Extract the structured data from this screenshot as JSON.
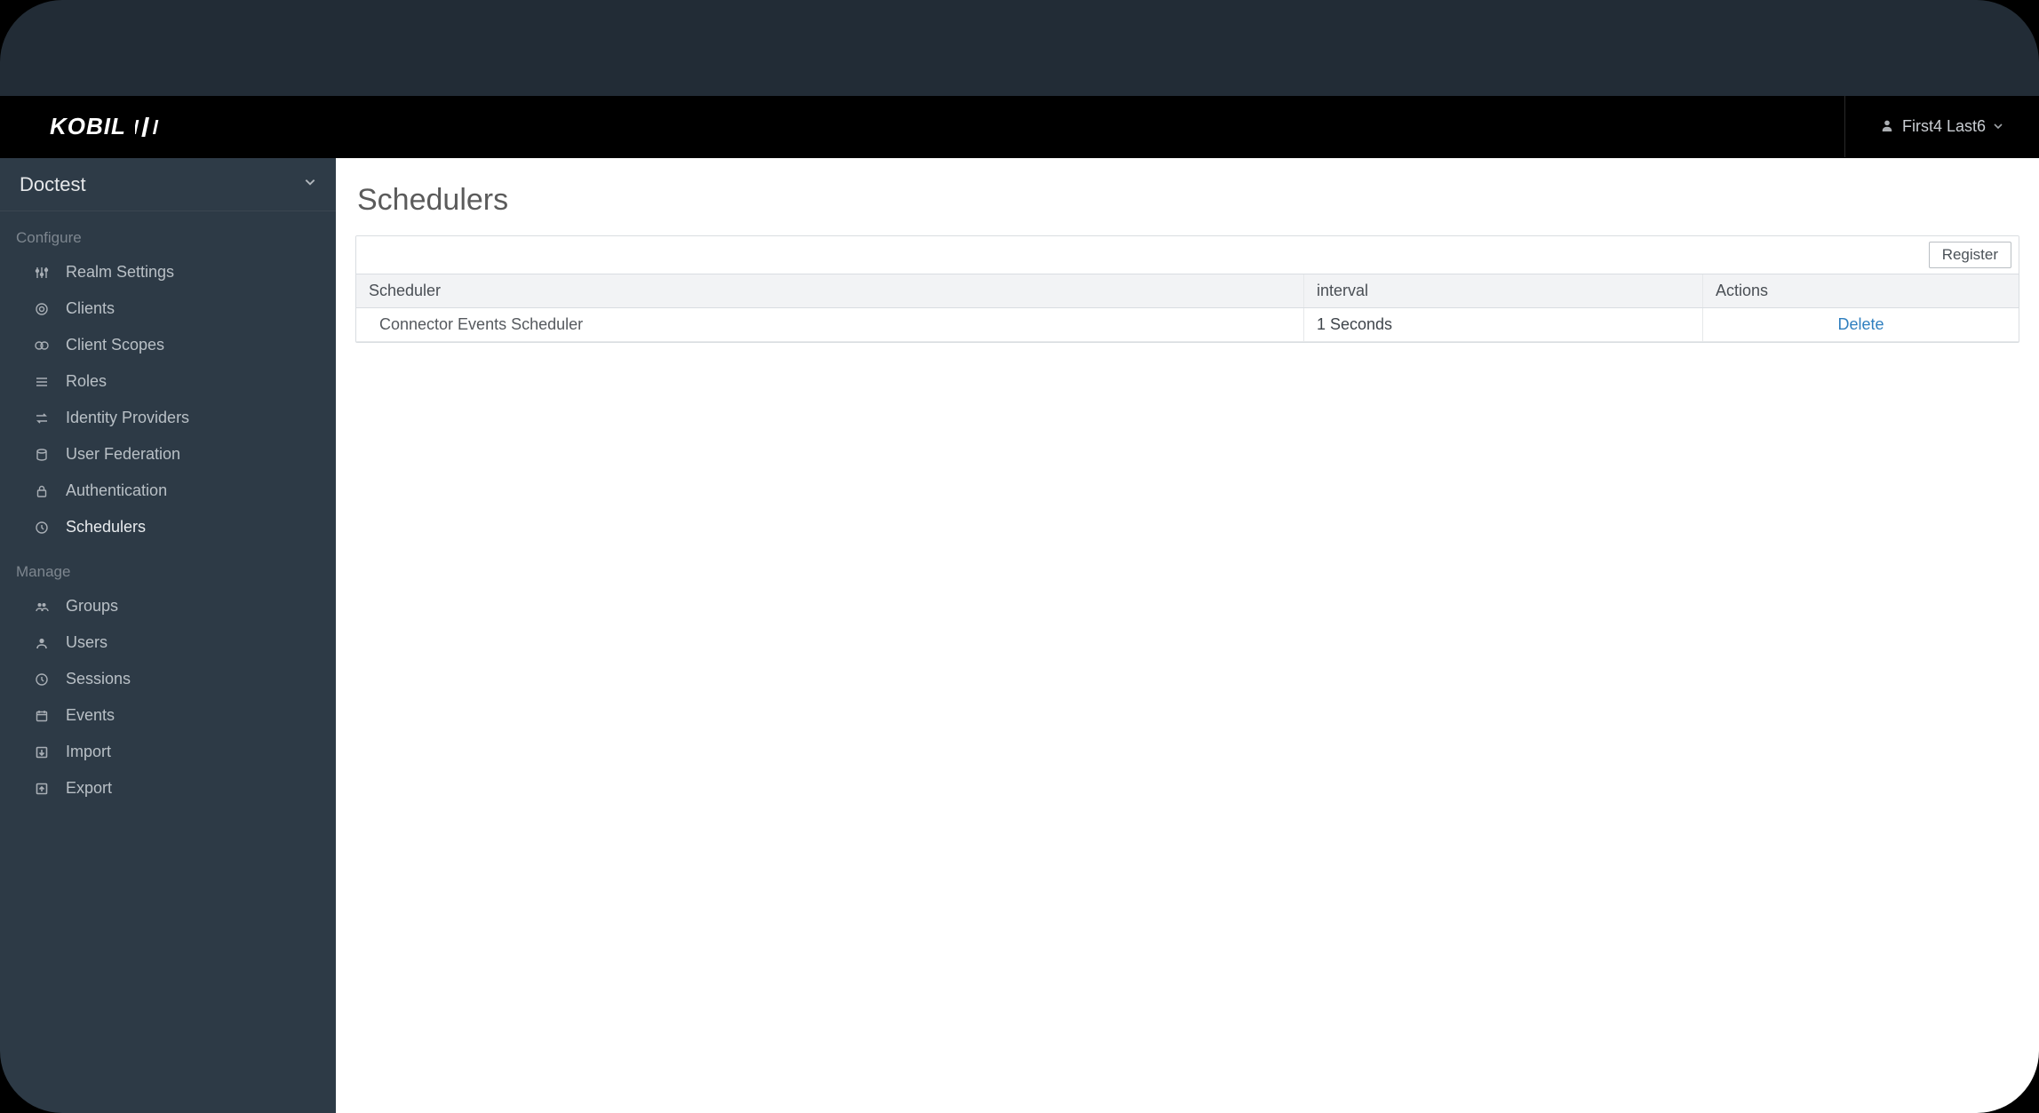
{
  "brand": {
    "name": "KOBIL"
  },
  "header": {
    "user_label": "First4 Last6"
  },
  "sidebar": {
    "realm_label": "Doctest",
    "sections": [
      {
        "title": "Configure",
        "items": [
          {
            "id": "realm-settings",
            "label": "Realm Settings",
            "icon": "sliders"
          },
          {
            "id": "clients",
            "label": "Clients",
            "icon": "target"
          },
          {
            "id": "client-scopes",
            "label": "Client Scopes",
            "icon": "scopes"
          },
          {
            "id": "roles",
            "label": "Roles",
            "icon": "list"
          },
          {
            "id": "identity-providers",
            "label": "Identity Providers",
            "icon": "swap"
          },
          {
            "id": "user-federation",
            "label": "User Federation",
            "icon": "stack"
          },
          {
            "id": "authentication",
            "label": "Authentication",
            "icon": "lock"
          },
          {
            "id": "schedulers",
            "label": "Schedulers",
            "icon": "clock",
            "active": true
          }
        ]
      },
      {
        "title": "Manage",
        "items": [
          {
            "id": "groups",
            "label": "Groups",
            "icon": "users"
          },
          {
            "id": "users",
            "label": "Users",
            "icon": "user"
          },
          {
            "id": "sessions",
            "label": "Sessions",
            "icon": "clock"
          },
          {
            "id": "events",
            "label": "Events",
            "icon": "calendar"
          },
          {
            "id": "import",
            "label": "Import",
            "icon": "import"
          },
          {
            "id": "export",
            "label": "Export",
            "icon": "export"
          }
        ]
      }
    ]
  },
  "page": {
    "title": "Schedulers",
    "register_label": "Register",
    "columns": {
      "scheduler": "Scheduler",
      "interval": "interval",
      "actions": "Actions"
    },
    "rows": [
      {
        "name": "Connector Events Scheduler",
        "interval": "1 Seconds",
        "action_label": "Delete"
      }
    ]
  }
}
